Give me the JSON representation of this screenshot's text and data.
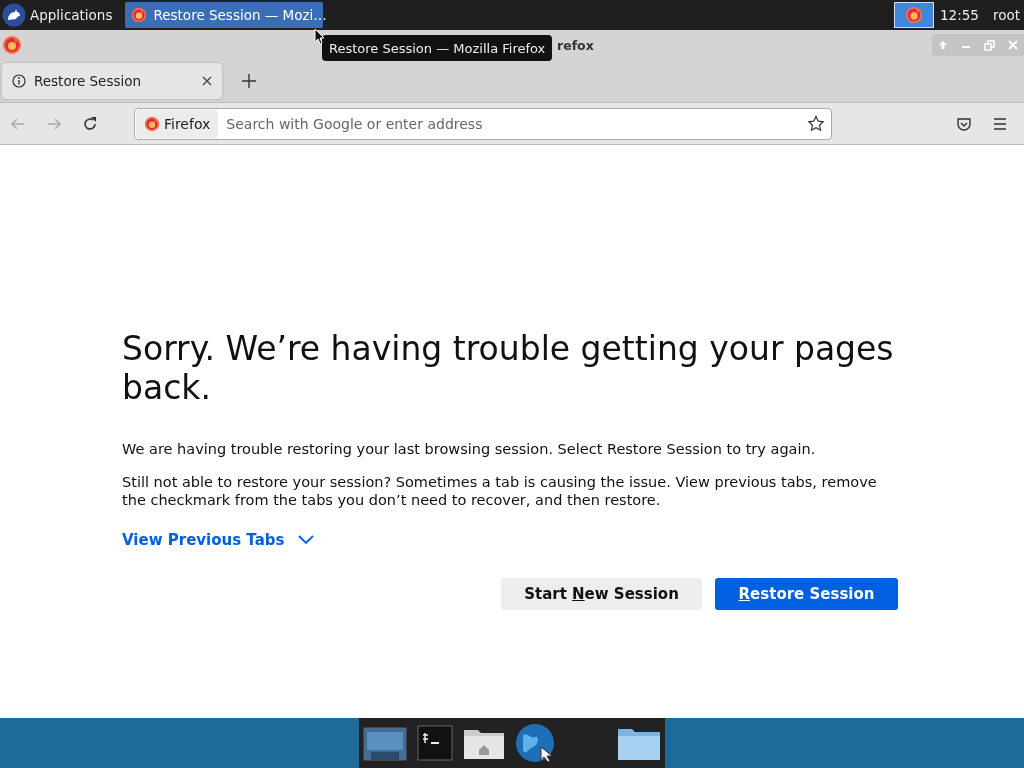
{
  "top_panel": {
    "applications": "Applications",
    "task": {
      "title": "Restore Session — Mozi…",
      "selected": true
    },
    "clock": "12:55",
    "user": "root"
  },
  "window": {
    "title": "refox",
    "tooltip": "Restore Session — Mozilla Firefox"
  },
  "tabs": [
    {
      "label": "Restore Session",
      "selected": true
    }
  ],
  "navigation": {
    "back_disabled": true,
    "forward_disabled": true
  },
  "address_bar": {
    "identity": "Firefox",
    "placeholder": "Search with Google or enter address"
  },
  "page": {
    "heading": "Sorry. We’re having trouble getting your pages back.",
    "paragraphs": [
      "We are having trouble restoring your last browsing session. Select Restore Session to try again.",
      "Still not able to restore your session? Sometimes a tab is causing the issue. View previous tabs, remove the checkmark from the tabs you don’t need to recover, and then restore."
    ],
    "link": "View Previous Tabs",
    "buttons": [
      {
        "kind": "secondary",
        "before": "Start ",
        "key": "N",
        "after": "ew Session"
      },
      {
        "kind": "primary",
        "key": "R",
        "after": "estore Session"
      }
    ]
  }
}
